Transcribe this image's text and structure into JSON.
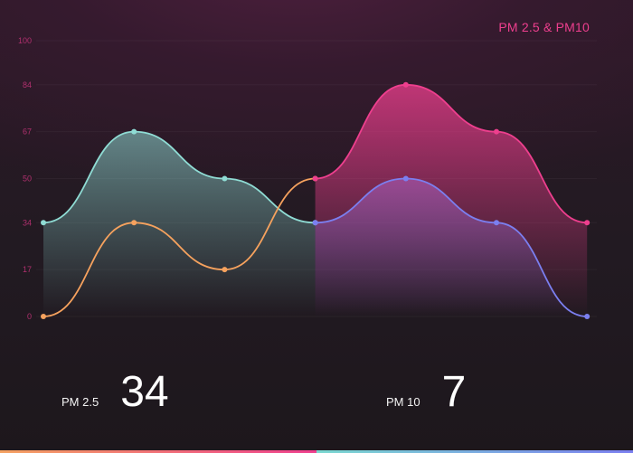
{
  "header": {
    "title": "PM 2.5 & PM10"
  },
  "stats": {
    "pm25": {
      "label": "PM 2.5",
      "value": "34"
    },
    "pm10": {
      "label": "PM 10",
      "value": "7"
    }
  },
  "colors": {
    "teal": "#8fdcd4",
    "blue": "#7b7ff0",
    "orange": "#f6a25e",
    "pink": "#ee3f8e",
    "axis_text": "#b0306e",
    "title": "#ee3f8e"
  },
  "chart_data": {
    "type": "area",
    "title": "PM 2.5 & PM10",
    "xlabel": "",
    "ylabel": "",
    "ylim": [
      0,
      100
    ],
    "yticks": [
      "100",
      "84",
      "67",
      "50",
      "34",
      "17",
      "0"
    ],
    "grid": true,
    "x": [
      0,
      1,
      2,
      3,
      4,
      5,
      6
    ],
    "series": [
      {
        "color": "#8fdcd4",
        "fill": true,
        "x": [
          0,
          1,
          2,
          3
        ],
        "values": [
          34,
          67,
          50,
          34
        ]
      },
      {
        "color": "#7b7ff0",
        "fill": true,
        "x": [
          3,
          4,
          5,
          6
        ],
        "values": [
          34,
          50,
          34,
          0
        ]
      },
      {
        "color": "#f6a25e",
        "fill": false,
        "x": [
          0,
          1,
          2,
          3
        ],
        "values": [
          0,
          34,
          17,
          50
        ]
      },
      {
        "color": "#ee3f8e",
        "fill": true,
        "x": [
          3,
          4,
          5,
          6
        ],
        "values": [
          50,
          84,
          67,
          34
        ]
      }
    ]
  }
}
